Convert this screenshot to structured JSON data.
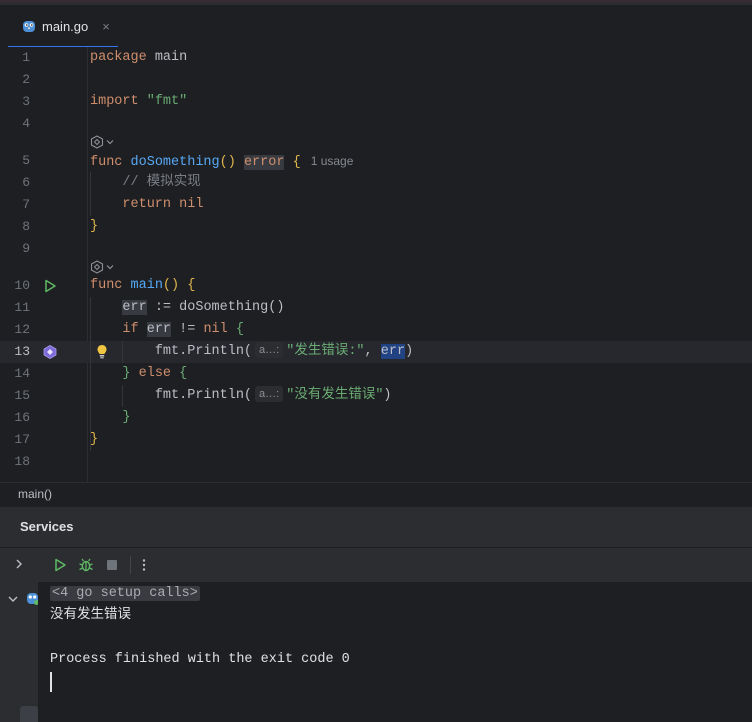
{
  "tab": {
    "label": "main.go",
    "close": "×"
  },
  "editor": {
    "lines": [
      {
        "n": "1"
      },
      {
        "n": "2"
      },
      {
        "n": "3"
      },
      {
        "n": "4"
      },
      {
        "n": "5"
      },
      {
        "n": "6"
      },
      {
        "n": "7"
      },
      {
        "n": "8"
      },
      {
        "n": "9"
      },
      {
        "n": "10"
      },
      {
        "n": "11"
      },
      {
        "n": "12"
      },
      {
        "n": "13"
      },
      {
        "n": "14"
      },
      {
        "n": "15"
      },
      {
        "n": "16"
      },
      {
        "n": "17"
      },
      {
        "n": "18"
      }
    ],
    "kw_package": "package",
    "pkg_name": "main",
    "kw_import": "import",
    "import_path": "\"fmt\"",
    "kw_func": "func",
    "fn_doSomething": "doSomething",
    "parens": "()",
    "type_error": "error",
    "brace_open": "{",
    "usage_hint": "1 usage",
    "comment": "// 模拟实现",
    "kw_return": "return",
    "nil": "nil",
    "brace_close": "}",
    "fn_main": "main",
    "var_err": "err",
    "assign": ":=",
    "call_doSomething": "doSomething()",
    "kw_if": "if",
    "neq": "!=",
    "println": "fmt.Println(",
    "inlay_a": "a…:",
    "str_error": "\"发生错误:\"",
    "comma": ",",
    "paren_close": ")",
    "kw_else": "else",
    "str_ok": "\"没有发生错误\""
  },
  "breadcrumb": "main()",
  "services": {
    "title": "Services",
    "folded_calls": "<4 go setup calls>",
    "output_line": "没有发生错误",
    "finish_line": "Process finished with the exit code 0"
  }
}
